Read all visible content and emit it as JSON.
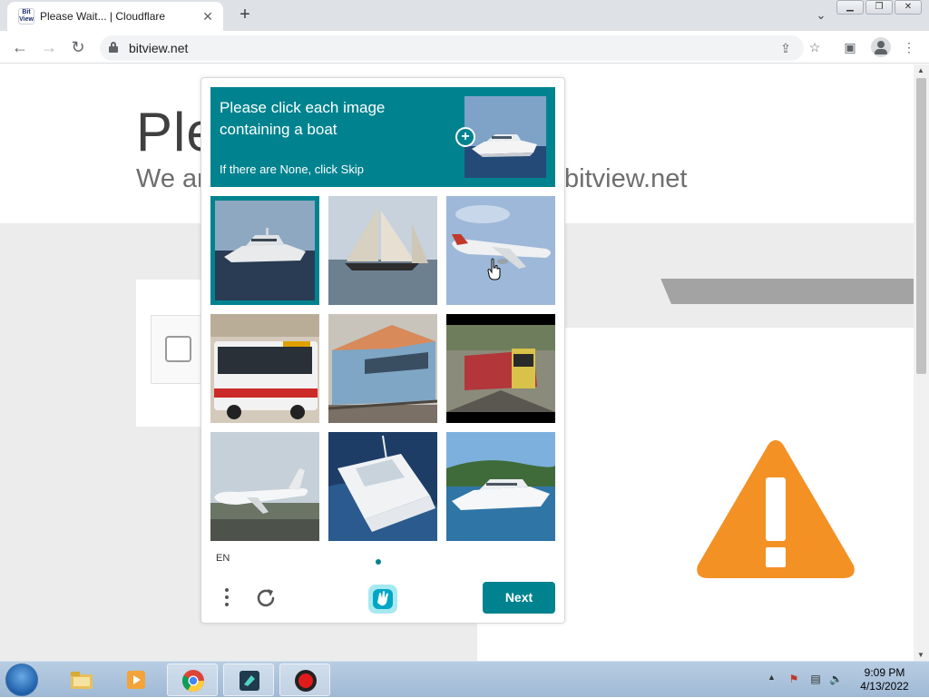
{
  "browser": {
    "tab_title": "Please Wait... | Cloudflare",
    "favicon_text_top": "Bit",
    "favicon_text_bottom": "View",
    "url": "bitview.net"
  },
  "page": {
    "heading": "Ple",
    "subheading": "We ar",
    "subheading_right": "bitview.net"
  },
  "captcha": {
    "prompt": "Please click each image containing a boat",
    "hint": "If there are None, click Skip",
    "language": "EN",
    "next_label": "Next",
    "accent_color": "#00838f",
    "tiles": [
      {
        "subject": "yacht on dark water",
        "selected": true
      },
      {
        "subject": "sailboat",
        "selected": false
      },
      {
        "subject": "airplane",
        "selected": false
      },
      {
        "subject": "bus",
        "selected": false
      },
      {
        "subject": "train",
        "selected": false
      },
      {
        "subject": "train at station",
        "selected": false
      },
      {
        "subject": "airplane landing",
        "selected": false
      },
      {
        "subject": "speedboat",
        "selected": false
      },
      {
        "subject": "yacht near shore",
        "selected": false
      }
    ]
  },
  "taskbar": {
    "time": "9:09 PM",
    "date": "4/13/2022"
  }
}
